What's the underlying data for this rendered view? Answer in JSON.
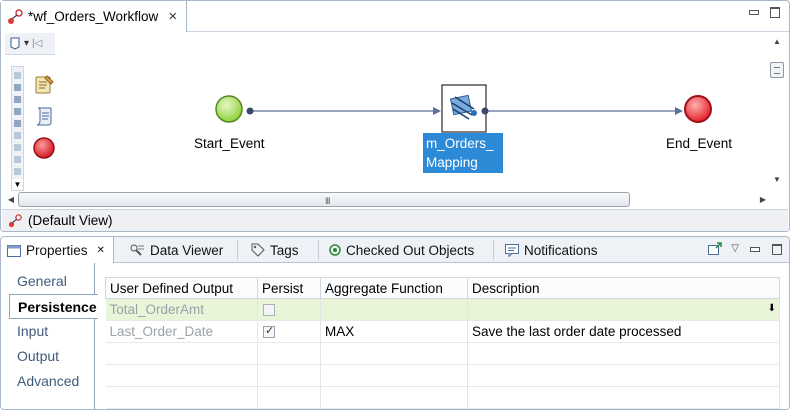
{
  "editor": {
    "tab_title": "*wf_Orders_Workflow",
    "view_label": "(Default View)"
  },
  "workflow": {
    "start_event": "Start_Event",
    "mapping_line1": "m_Orders_",
    "mapping_line2": "Mapping",
    "end_event": "End_Event"
  },
  "properties": {
    "tabs": [
      "Properties",
      "Data Viewer",
      "Tags",
      "Checked Out Objects",
      "Notifications"
    ],
    "nav": [
      "General",
      "Persistence",
      "Input",
      "Output",
      "Advanced"
    ],
    "active_nav": "Persistence",
    "table": {
      "columns": [
        "User Defined Output",
        "Persist",
        "Aggregate Function",
        "Description"
      ],
      "rows": [
        {
          "output": "Total_OrderAmt",
          "persist": false,
          "aggregate": "",
          "description": ""
        },
        {
          "output": "Last_Order_Date",
          "persist": true,
          "aggregate": "MAX",
          "description": "Save the last order date processed"
        }
      ]
    }
  },
  "colors": {
    "selection": "#2d8ad6",
    "start_event": "#8fd13f",
    "end_event": "#e5202a",
    "selected_row": "#e9f5d8"
  },
  "icons": {
    "workflow": "workflow-icon",
    "mapping": "mapping-icon",
    "properties": "properties-icon",
    "data_viewer": "data-viewer-icon",
    "tags": "tag-icon",
    "checked_out": "checked-out-icon",
    "notifications": "notification-icon"
  }
}
